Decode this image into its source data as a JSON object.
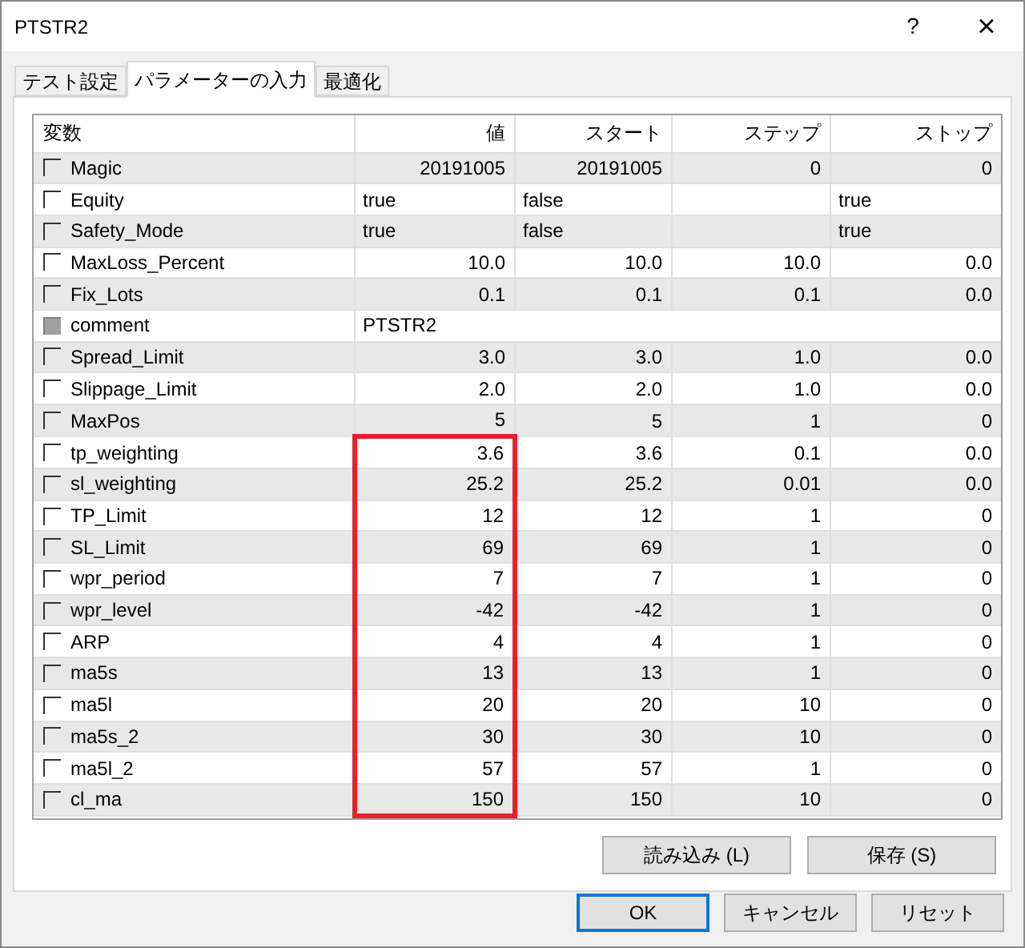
{
  "window": {
    "title": "PTSTR2",
    "help": "?",
    "close": "×"
  },
  "tabs": [
    {
      "label": "テスト設定",
      "selected": false
    },
    {
      "label": "パラメーターの入力",
      "selected": true
    },
    {
      "label": "最適化",
      "selected": false
    }
  ],
  "table": {
    "columns": [
      "変数",
      "値",
      "スタート",
      "ステップ",
      "ストップ"
    ],
    "rows": [
      {
        "name": "Magic",
        "checked": false,
        "disabled": false,
        "kind": "number",
        "value": "20191005",
        "start": "20191005",
        "step": "0",
        "stop": "0",
        "highlighted": false
      },
      {
        "name": "Equity",
        "checked": false,
        "disabled": false,
        "kind": "boolean",
        "value": "true",
        "start": "false",
        "stop": "true",
        "highlighted": false
      },
      {
        "name": "Safety_Mode",
        "checked": false,
        "disabled": false,
        "kind": "boolean",
        "value": "true",
        "start": "false",
        "stop": "true",
        "highlighted": false
      },
      {
        "name": "MaxLoss_Percent",
        "checked": false,
        "disabled": false,
        "kind": "number",
        "value": "10.0",
        "start": "10.0",
        "step": "10.0",
        "stop": "0.0",
        "highlighted": false
      },
      {
        "name": "Fix_Lots",
        "checked": false,
        "disabled": false,
        "kind": "number",
        "value": "0.1",
        "start": "0.1",
        "step": "0.1",
        "stop": "0.0",
        "highlighted": false
      },
      {
        "name": "comment",
        "checked": false,
        "disabled": true,
        "kind": "string",
        "value": "PTSTR2",
        "highlighted": false
      },
      {
        "name": "Spread_Limit",
        "checked": false,
        "disabled": false,
        "kind": "number",
        "value": "3.0",
        "start": "3.0",
        "step": "1.0",
        "stop": "0.0",
        "highlighted": false
      },
      {
        "name": "Slippage_Limit",
        "checked": false,
        "disabled": false,
        "kind": "number",
        "value": "2.0",
        "start": "2.0",
        "step": "1.0",
        "stop": "0.0",
        "highlighted": false
      },
      {
        "name": "MaxPos",
        "checked": false,
        "disabled": false,
        "kind": "number",
        "value": "5",
        "start": "5",
        "step": "1",
        "stop": "0",
        "highlighted": false
      },
      {
        "name": "tp_weighting",
        "checked": false,
        "disabled": false,
        "kind": "number",
        "value": "3.6",
        "start": "3.6",
        "step": "0.1",
        "stop": "0.0",
        "highlighted": true
      },
      {
        "name": "sl_weighting",
        "checked": false,
        "disabled": false,
        "kind": "number",
        "value": "25.2",
        "start": "25.2",
        "step": "0.01",
        "stop": "0.0",
        "highlighted": true
      },
      {
        "name": "TP_Limit",
        "checked": false,
        "disabled": false,
        "kind": "number",
        "value": "12",
        "start": "12",
        "step": "1",
        "stop": "0",
        "highlighted": true
      },
      {
        "name": "SL_Limit",
        "checked": false,
        "disabled": false,
        "kind": "number",
        "value": "69",
        "start": "69",
        "step": "1",
        "stop": "0",
        "highlighted": true
      },
      {
        "name": "wpr_period",
        "checked": false,
        "disabled": false,
        "kind": "number",
        "value": "7",
        "start": "7",
        "step": "1",
        "stop": "0",
        "highlighted": true
      },
      {
        "name": "wpr_level",
        "checked": false,
        "disabled": false,
        "kind": "number",
        "value": "-42",
        "start": "-42",
        "step": "1",
        "stop": "0",
        "highlighted": true
      },
      {
        "name": "ARP",
        "checked": false,
        "disabled": false,
        "kind": "number",
        "value": "4",
        "start": "4",
        "step": "1",
        "stop": "0",
        "highlighted": true
      },
      {
        "name": "ma5s",
        "checked": false,
        "disabled": false,
        "kind": "number",
        "value": "13",
        "start": "13",
        "step": "1",
        "stop": "0",
        "highlighted": true
      },
      {
        "name": "ma5l",
        "checked": false,
        "disabled": false,
        "kind": "number",
        "value": "20",
        "start": "20",
        "step": "10",
        "stop": "0",
        "highlighted": true
      },
      {
        "name": "ma5s_2",
        "checked": false,
        "disabled": false,
        "kind": "number",
        "value": "30",
        "start": "30",
        "step": "10",
        "stop": "0",
        "highlighted": true
      },
      {
        "name": "ma5l_2",
        "checked": false,
        "disabled": false,
        "kind": "number",
        "value": "57",
        "start": "57",
        "step": "1",
        "stop": "0",
        "highlighted": true
      },
      {
        "name": "cl_ma",
        "checked": false,
        "disabled": false,
        "kind": "number",
        "value": "150",
        "start": "150",
        "step": "10",
        "stop": "0",
        "highlighted": true
      }
    ]
  },
  "panel_buttons": [
    "読み込み (L)",
    "保存 (S)"
  ],
  "dialog_buttons": [
    {
      "label": "OK",
      "default": true
    },
    {
      "label": "キャンセル",
      "default": false
    },
    {
      "label": "リセット",
      "default": false
    }
  ]
}
